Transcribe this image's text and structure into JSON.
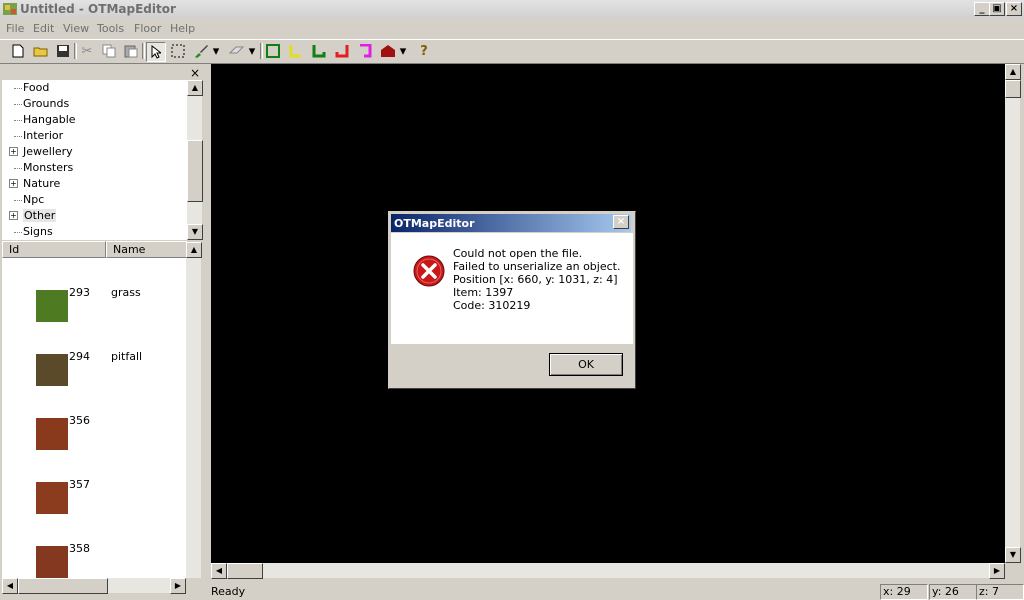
{
  "window": {
    "title": "Untitled - OTMapEditor",
    "controls": [
      "_",
      "▣",
      "×"
    ]
  },
  "menu": [
    "File",
    "Edit",
    "View",
    "Tools",
    "Floor",
    "Help"
  ],
  "toolbar": {
    "icons": [
      "new-file-icon",
      "open-folder-icon",
      "save-icon",
      "cut-icon",
      "copy-icon",
      "paste-icon",
      "pointer-icon",
      "select-rect-icon",
      "brush-icon",
      "eraser-icon",
      "border-green-icon",
      "border-yellow-icon",
      "border-green2-icon",
      "border-red-icon",
      "border-magenta-icon",
      "house-icon",
      "help-icon"
    ]
  },
  "tree": {
    "close_glyph": "×",
    "items": [
      {
        "label": "Food",
        "expandable": false
      },
      {
        "label": "Grounds",
        "expandable": false
      },
      {
        "label": "Hangable",
        "expandable": false
      },
      {
        "label": "Interior",
        "expandable": false
      },
      {
        "label": "Jewellery",
        "expandable": true
      },
      {
        "label": "Monsters",
        "expandable": false
      },
      {
        "label": "Nature",
        "expandable": true
      },
      {
        "label": "Npc",
        "expandable": false
      },
      {
        "label": "Other",
        "expandable": true,
        "selected": true
      },
      {
        "label": "Signs",
        "expandable": false
      }
    ]
  },
  "list": {
    "headers": [
      "Id",
      "Name"
    ],
    "rows": [
      {
        "id": "293",
        "name": "grass",
        "thumb": "#4e7a22"
      },
      {
        "id": "294",
        "name": "pitfall",
        "thumb": "#5a4a2a"
      },
      {
        "id": "356",
        "name": "",
        "thumb": "#8a3a1c"
      },
      {
        "id": "357",
        "name": "",
        "thumb": "#8c3c1e"
      },
      {
        "id": "358",
        "name": "",
        "thumb": "#843820"
      }
    ]
  },
  "status": {
    "text": "Ready",
    "x": "x: 29",
    "y": "y: 26",
    "z": "z: 7"
  },
  "dialog": {
    "title": "OTMapEditor",
    "close": "×",
    "lines": [
      "Could not open the file.",
      "Failed to unserialize an object.",
      "Position [x: 660, y: 1031, z: 4]",
      "Item: 1397",
      "Code: 310219"
    ],
    "ok": "OK"
  }
}
